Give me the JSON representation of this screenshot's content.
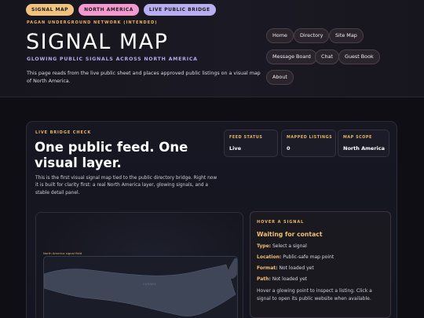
{
  "header": {
    "pills": [
      "SIGNAL MAP",
      "NORTH AMERICA",
      "LIVE PUBLIC BRIDGE"
    ],
    "kicker": "PAGAN UNDERGROUND NETWORK (INTENDED)",
    "title": "SIGNAL MAP",
    "subtitle": "GLOWING PUBLIC SIGNALS ACROSS NORTH AMERICA",
    "description": "This page reads from the live public sheet and places approved public listings on a visual map of North America."
  },
  "nav": [
    "Home",
    "Directory",
    "Site Map",
    "Message Board",
    "Chat",
    "Guest Book",
    "About"
  ],
  "panel": {
    "kicker": "LIVE BRIDGE CHECK",
    "title": "One public feed. One visual layer.",
    "description": "This is the first visual signal map tied to the public directory bridge. Right now it is built for clarity first: a real North America layer, glowing signals, and a stable detail panel.",
    "stats": [
      {
        "label": "FEED STATUS",
        "value": "Live"
      },
      {
        "label": "MAPPED LISTINGS",
        "value": "0"
      },
      {
        "label": "MAP SCOPE",
        "value": "North America"
      }
    ]
  },
  "map": {
    "field_label": "North America signal field",
    "region_label": "CANADA"
  },
  "hover": {
    "kicker": "HOVER A SIGNAL",
    "title": "Waiting for contact",
    "rows": [
      {
        "key": "Type:",
        "value": "Select a signal"
      },
      {
        "key": "Location:",
        "value": "Public-safe map point"
      },
      {
        "key": "Format:",
        "value": "Not loaded yet"
      },
      {
        "key": "Path:",
        "value": "Not loaded yet"
      }
    ],
    "note": "Hover a glowing point to inspect a listing. Click a signal to open its public website when available."
  },
  "colors": {
    "accent_gold": "#e8b665",
    "accent_lavender": "#b6a9f0",
    "background": "#0f0e15"
  }
}
